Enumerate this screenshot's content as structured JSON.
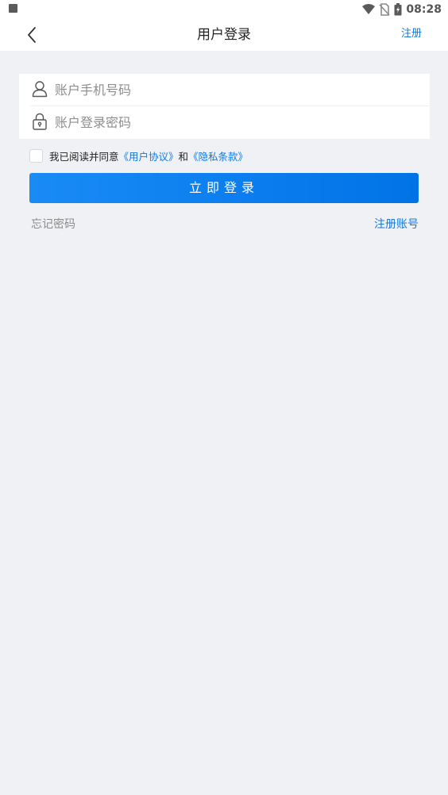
{
  "status_bar": {
    "time": "08:28",
    "left_icon": "a-badge-icon",
    "icons": [
      "wifi-icon",
      "no-sim-icon",
      "battery-icon"
    ]
  },
  "nav": {
    "title": "用户登录",
    "action": "注册",
    "back_icon": "chevron-left-icon"
  },
  "form": {
    "phone": {
      "placeholder": "账户手机号码",
      "value": "",
      "icon": "user-icon"
    },
    "password": {
      "placeholder": "账户登录密码",
      "value": "",
      "icon": "lock-icon"
    }
  },
  "agreement": {
    "checked": false,
    "prefix": "我已阅读并同意",
    "user_agreement": "《用户协议》",
    "conjunction": "和",
    "privacy_policy": "《隐私条款》"
  },
  "login_button": {
    "label": "立即登录"
  },
  "links": {
    "forgot_password": "忘记密码",
    "register_account": "注册账号"
  },
  "colors": {
    "accent": "#1677d8",
    "button_start": "#1a8bf5",
    "button_end": "#0073e6",
    "page_background": "#eff1f4"
  }
}
